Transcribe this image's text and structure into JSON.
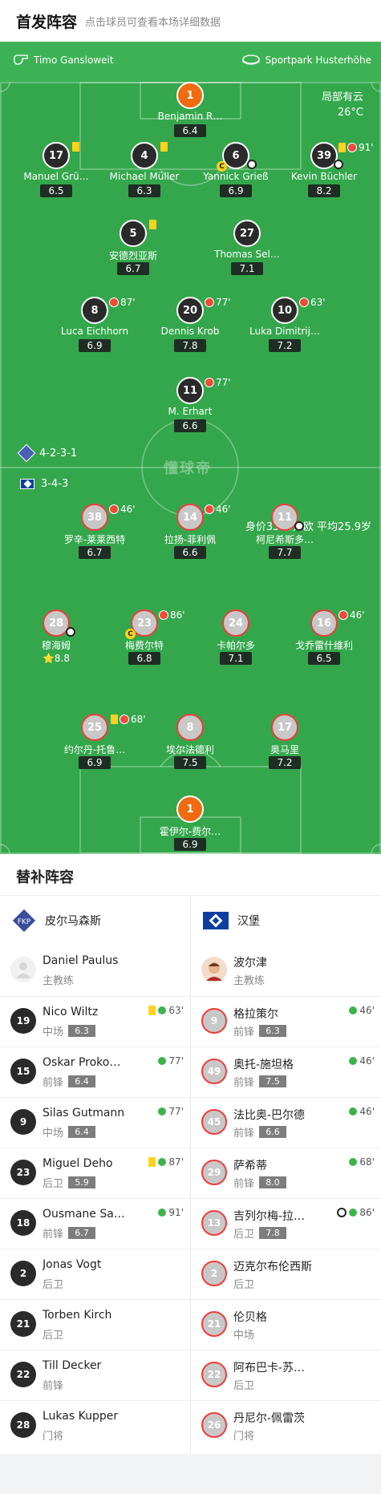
{
  "header": {
    "title": "首发阵容",
    "subtitle": "点击球员可查看本场详细数据"
  },
  "pitch": {
    "referee": "Timo Gansloweit",
    "stadium": "Sportpark Husterhöhe",
    "weather": "局部有云",
    "temperature": "26°C",
    "home_formation": "4-2-3-1",
    "away_formation": "3-4-3",
    "away_value": "身价3540万欧 平均25.9岁",
    "watermark": "懂球帝",
    "home": [
      {
        "num": "1",
        "name": "Benjamin R…",
        "rating": "6.4"
      },
      {
        "num": "17",
        "name": "Manuel Grü…",
        "rating": "6.5"
      },
      {
        "num": "4",
        "name": "Michael Müller",
        "rating": "6.3"
      },
      {
        "num": "6",
        "name": "Yannick Grieß",
        "rating": "6.9"
      },
      {
        "num": "39",
        "name": "Kevin Büchler",
        "rating": "8.2",
        "ev": "91'"
      },
      {
        "num": "5",
        "name": "安德烈亚斯",
        "rating": "6.7"
      },
      {
        "num": "27",
        "name": "Thomas Sel…",
        "rating": "7.1"
      },
      {
        "num": "8",
        "name": "Luca Eichhorn",
        "rating": "6.9",
        "ev": "87'"
      },
      {
        "num": "20",
        "name": "Dennis Krob",
        "rating": "7.8",
        "ev": "77'"
      },
      {
        "num": "10",
        "name": "Luka Dimitrij…",
        "rating": "7.2",
        "ev": "63'"
      },
      {
        "num": "11",
        "name": "M. Erhart",
        "rating": "6.6",
        "ev": "77'"
      }
    ],
    "away": [
      {
        "num": "38",
        "name": "罗辛-莱莱西特",
        "rating": "6.7",
        "ev": "46'"
      },
      {
        "num": "14",
        "name": "拉扬-菲利佩",
        "rating": "6.6",
        "ev": "46'"
      },
      {
        "num": "11",
        "name": "柯尼希斯多…",
        "rating": "7.7"
      },
      {
        "num": "28",
        "name": "穆海姆",
        "rating": "8.8"
      },
      {
        "num": "23",
        "name": "梅费尔特",
        "rating": "6.8",
        "ev": "86'"
      },
      {
        "num": "24",
        "name": "卡帕尔多",
        "rating": "7.1"
      },
      {
        "num": "16",
        "name": "戈乔雷什维利",
        "rating": "6.5",
        "ev": "46'"
      },
      {
        "num": "25",
        "name": "约尔丹-托鲁…",
        "rating": "6.9",
        "ev": "68'"
      },
      {
        "num": "8",
        "name": "埃尔法德利",
        "rating": "7.5"
      },
      {
        "num": "17",
        "name": "奥马里",
        "rating": "7.2"
      },
      {
        "num": "1",
        "name": "霍伊尔-费尔…",
        "rating": "6.9"
      }
    ]
  },
  "subs": {
    "title": "替补阵容",
    "home_team": "皮尔马森斯",
    "away_team": "汉堡",
    "home_coach": {
      "name": "Daniel Paulus",
      "role": "主教练"
    },
    "away_coach": {
      "name": "波尔津",
      "role": "主教练"
    },
    "home": [
      {
        "num": "19",
        "name": "Nico Wiltz",
        "pos": "中场",
        "rating": "6.3",
        "ev": "63'"
      },
      {
        "num": "15",
        "name": "Oskar Proko…",
        "pos": "前锋",
        "rating": "6.4",
        "ev": "77'"
      },
      {
        "num": "9",
        "name": "Silas Gutmann",
        "pos": "中场",
        "rating": "6.4",
        "ev": "77'"
      },
      {
        "num": "23",
        "name": "Miguel Deho",
        "pos": "后卫",
        "rating": "5.9",
        "ev": "87'"
      },
      {
        "num": "18",
        "name": "Ousmane Sa…",
        "pos": "前锋",
        "rating": "6.7",
        "ev": "91'"
      },
      {
        "num": "2",
        "name": "Jonas Vogt",
        "pos": "后卫"
      },
      {
        "num": "21",
        "name": "Torben Kirch",
        "pos": "后卫"
      },
      {
        "num": "22",
        "name": "Till Decker",
        "pos": "前锋"
      },
      {
        "num": "28",
        "name": "Lukas Kupper",
        "pos": "门将"
      }
    ],
    "away": [
      {
        "num": "9",
        "name": "格拉策尔",
        "pos": "前锋",
        "rating": "6.3",
        "ev": "46'"
      },
      {
        "num": "49",
        "name": "奥托-施坦格",
        "pos": "前锋",
        "rating": "7.5",
        "ev": "46'"
      },
      {
        "num": "45",
        "name": "法比奥-巴尔德",
        "pos": "前锋",
        "rating": "6.6",
        "ev": "46'"
      },
      {
        "num": "29",
        "name": "萨希蒂",
        "pos": "前锋",
        "rating": "8.0",
        "ev": "68'"
      },
      {
        "num": "13",
        "name": "吉列尔梅-拉…",
        "pos": "后卫",
        "rating": "7.8",
        "ev": "86'"
      },
      {
        "num": "2",
        "name": "迈克尔布伦西斯",
        "pos": "后卫"
      },
      {
        "num": "21",
        "name": "伦贝格",
        "pos": "中场"
      },
      {
        "num": "22",
        "name": "阿布巴卡-苏…",
        "pos": "后卫"
      },
      {
        "num": "26",
        "name": "丹尼尔-佩雷茨",
        "pos": "门将"
      }
    ]
  }
}
